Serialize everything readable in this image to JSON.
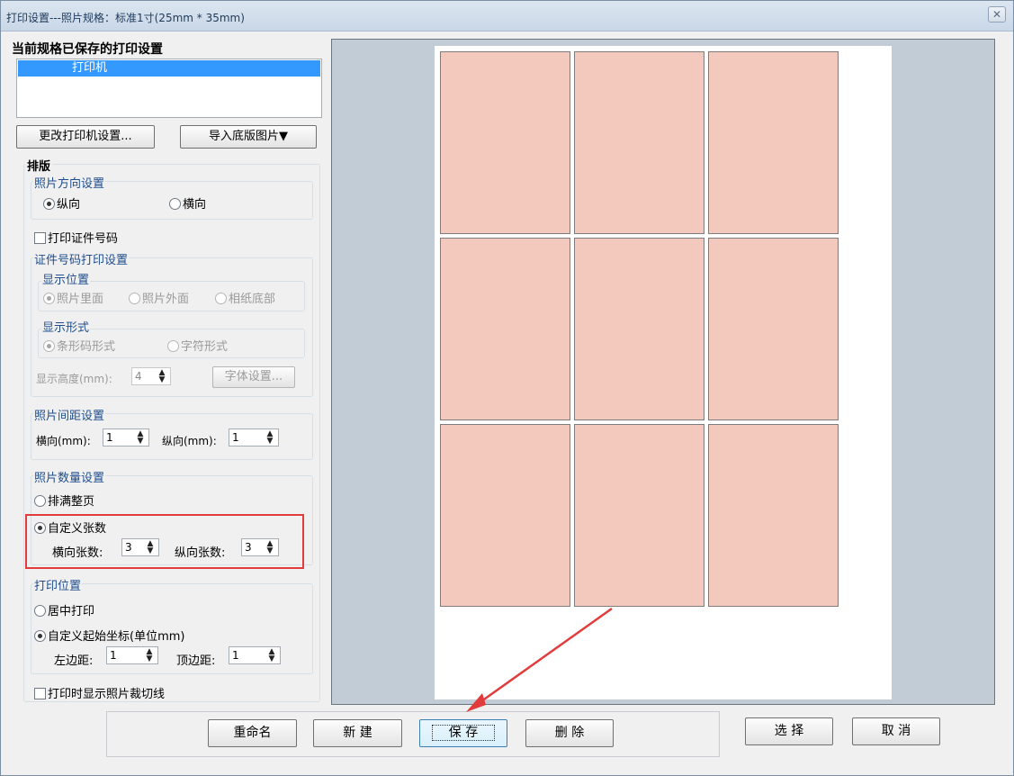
{
  "window": {
    "title": "打印设置---照片规格：标准1寸(25mm * 35mm)",
    "close_glyph": "✕"
  },
  "saved": {
    "title": "当前规格已保存的打印设置",
    "printer_item": "打印机"
  },
  "buttons": {
    "change_printer": "更改打印机设置...",
    "import_template": "导入底版图片▼"
  },
  "layout": {
    "section_title": "排版",
    "orientation": {
      "label": "照片方向设置",
      "portrait": "纵向",
      "landscape": "横向",
      "selected": "portrait"
    },
    "print_id_checkbox": "打印证件号码",
    "id_print_settings": {
      "label": "证件号码打印设置",
      "position": {
        "label": "显示位置",
        "inside": "照片里面",
        "outside": "照片外面",
        "bottom": "相纸底部"
      },
      "form": {
        "label": "显示形式",
        "barcode": "条形码形式",
        "text": "字符形式"
      },
      "height_label": "显示高度(mm):",
      "height_value": "4",
      "font_button": "字体设置..."
    },
    "spacing": {
      "label": "照片间距设置",
      "horizontal_label": "横向(mm):",
      "horizontal_value": "1",
      "vertical_label": "纵向(mm):",
      "vertical_value": "1"
    },
    "count": {
      "label": "照片数量设置",
      "fill_page": "排满整页",
      "custom": "自定义张数",
      "horizontal_label": "横向张数:",
      "horizontal_value": "3",
      "vertical_label": "纵向张数:",
      "vertical_value": "3",
      "selected": "custom"
    },
    "position": {
      "label": "打印位置",
      "center": "居中打印",
      "custom": "自定义起始坐标(单位mm)",
      "left_label": "左边距:",
      "left_value": "1",
      "top_label": "顶边距:",
      "top_value": "1",
      "selected": "custom"
    },
    "show_cut_lines": "打印时显示照片裁切线"
  },
  "preview": {
    "columns": 3,
    "rows": 3,
    "photo_color": "#f2c9bc"
  },
  "bottom": {
    "rename": "重命名",
    "new": "新 建",
    "save": "保 存",
    "delete": "删 除",
    "select": "选 择",
    "cancel": "取 消"
  },
  "colors": {
    "highlight_frame": "#e23b3b",
    "arrow": "#e23b3b",
    "selection": "#3399ff"
  }
}
